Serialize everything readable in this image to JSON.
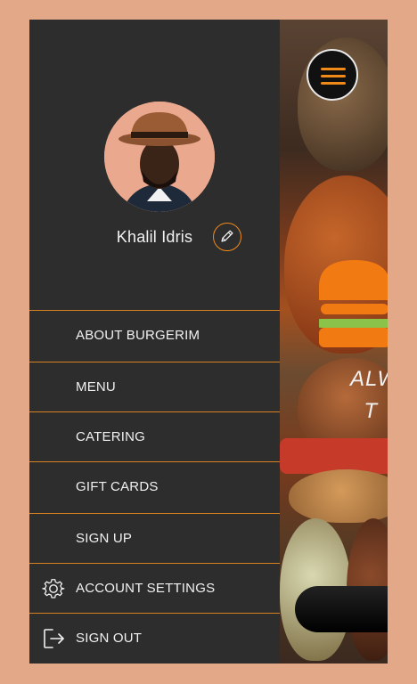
{
  "profile": {
    "name": "Khalil Idris"
  },
  "menu": {
    "items": [
      {
        "label": "ABOUT BURGERIM",
        "icon": null
      },
      {
        "label": "MENU",
        "icon": null
      },
      {
        "label": "CATERING",
        "icon": null
      },
      {
        "label": "GIFT CARDS",
        "icon": null
      },
      {
        "label": "SIGN UP",
        "icon": null
      },
      {
        "label": "ACCOUNT SETTINGS",
        "icon": "gear-icon"
      },
      {
        "label": "SIGN OUT",
        "icon": "sign-out-icon"
      }
    ]
  },
  "main": {
    "tagline": "ALW\n  T"
  },
  "colors": {
    "accent": "#F28A1A",
    "drawer_bg": "#2d2d2d",
    "page_bg": "#E2A888",
    "text": "#f1f1f1"
  }
}
